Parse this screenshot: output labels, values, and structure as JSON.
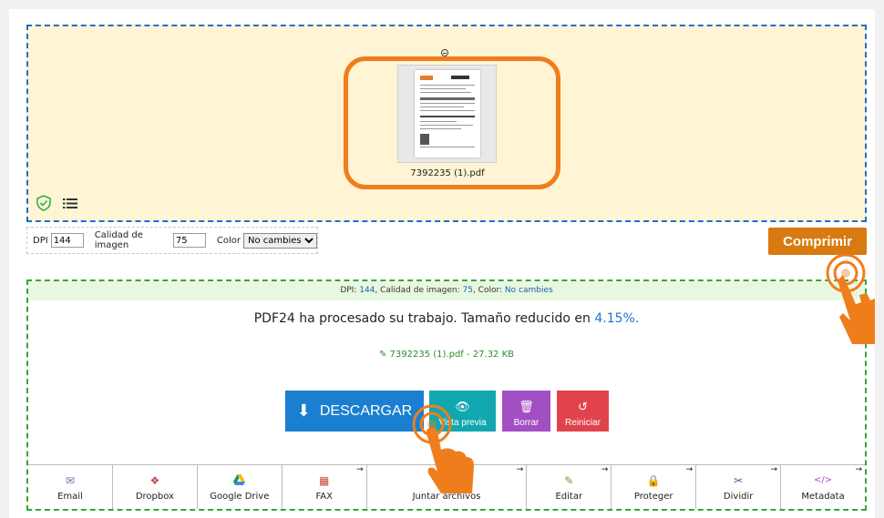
{
  "dropzone": {
    "file_name": "7392235 (1).pdf"
  },
  "options": {
    "dpi_label": "DPI",
    "dpi_value": "144",
    "quality_label": "Calidad de imagen",
    "quality_value": "75",
    "color_label": "Color",
    "color_value": "No cambies"
  },
  "compress_button": "Comprimir",
  "result": {
    "info_dpi_label": "DPI: ",
    "info_dpi": "144",
    "info_quality_label": ", Calidad de imagen: ",
    "info_quality": "75",
    "info_color_label": ", Color: ",
    "info_color": "No cambies",
    "message": "PDF24 ha procesado su trabajo. Tamaño reducido en ",
    "percent": "4.15%.",
    "file_line": "7392235 (1).pdf - 27.32 KB"
  },
  "actions": {
    "download": "DESCARGAR",
    "preview": "Vista previa",
    "delete": "Borrar",
    "restart": "Reiniciar"
  },
  "tools": [
    {
      "label": "Email",
      "icon": "envelope-icon"
    },
    {
      "label": "Dropbox",
      "icon": "dropbox-icon"
    },
    {
      "label": "Google Drive",
      "icon": "google-drive-icon"
    },
    {
      "label": "FAX",
      "icon": "fax-icon"
    },
    {
      "label": "Juntar archivos",
      "icon": "merge-icon"
    },
    {
      "label": "Editar",
      "icon": "pencil-icon"
    },
    {
      "label": "Proteger",
      "icon": "lock-icon"
    },
    {
      "label": "Dividir",
      "icon": "scissors-icon"
    },
    {
      "label": "Metadata",
      "icon": "code-icon"
    }
  ],
  "colors": {
    "accent_orange": "#d87a10",
    "dropzone_border": "#1f6ed4",
    "result_border": "#3aa43a",
    "download": "#1a7fd0",
    "preview": "#12a7b0",
    "delete": "#a24fc4",
    "restart": "#e0434b"
  }
}
